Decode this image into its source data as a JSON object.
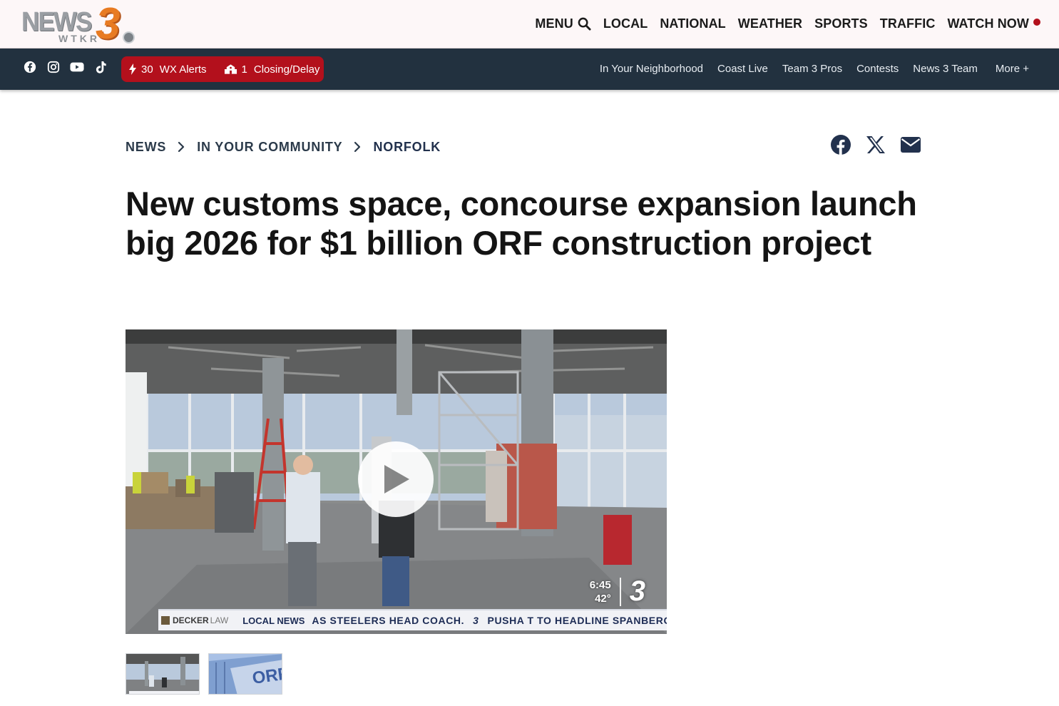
{
  "header": {
    "logo": {
      "news": "NEWS",
      "wtkr": "WTKR",
      "number": "3"
    },
    "nav": {
      "menu": "MENU",
      "items": [
        "LOCAL",
        "NATIONAL",
        "WEATHER",
        "SPORTS",
        "TRAFFIC"
      ],
      "watch_now": "WATCH NOW"
    }
  },
  "subbar": {
    "social_icons": [
      "facebook-icon",
      "instagram-icon",
      "youtube-icon",
      "tiktok-icon"
    ],
    "alerts": {
      "wx_count": "30",
      "wx_label": "WX Alerts",
      "closing_count": "1",
      "closing_label": "Closing/Delay"
    },
    "links": [
      "In Your Neighborhood",
      "Coast Live",
      "Team 3 Pros",
      "Contests",
      "News 3 Team"
    ],
    "more": "More +"
  },
  "breadcrumb": [
    "NEWS",
    "IN YOUR COMMUNITY",
    "NORFOLK"
  ],
  "share_icons": [
    "facebook-share-icon",
    "x-share-icon",
    "email-share-icon"
  ],
  "article": {
    "headline": "New customs space, concourse expansion launch big 2026 for $1 billion ORF construction project"
  },
  "video": {
    "bug_time": "6:45",
    "bug_temp": "42°",
    "bug_channel": "3",
    "ticker_sponsor": "DECKER",
    "ticker_sponsor_suffix": "LAW",
    "ticker_label": "LOCAL NEWS",
    "ticker_text_1": "AS STEELERS HEAD COACH.",
    "ticker_mark": "3",
    "ticker_text_2": "PUSHA T TO HEADLINE SPANBERGER I"
  },
  "colors": {
    "header_bg": "#fdf7f8",
    "subbar_bg": "#22313f",
    "alert_red": "#b3101c",
    "logo_orange": "#e87b22"
  }
}
